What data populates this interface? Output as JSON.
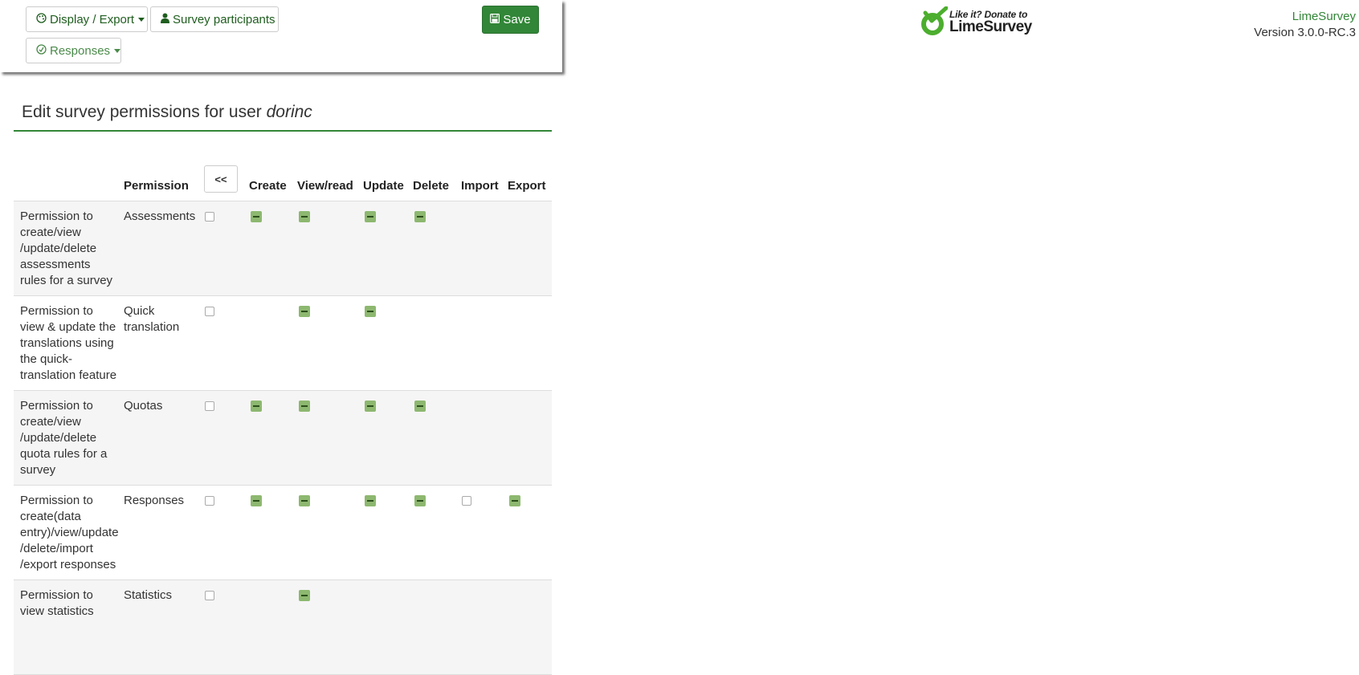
{
  "toolbar": {
    "display_export_label": "Display / Export",
    "survey_participants_label": "Survey participants",
    "responses_label": "Responses",
    "save_label": "Save"
  },
  "logo": {
    "small_text": "Like it? Donate to",
    "big_text": "LimeSurvey",
    "icon": "limesurvey-logo-icon"
  },
  "brand": {
    "name": "LimeSurvey",
    "version": "Version 3.0.0-RC.3"
  },
  "page": {
    "title_prefix": "Edit survey permissions for user ",
    "username": "dorinc"
  },
  "table": {
    "headers": {
      "permission": "Permission",
      "back_button": "<<",
      "create": "Create",
      "view": "View/read",
      "update": "Update",
      "delete": "Delete",
      "import": "Import",
      "export": "Export"
    },
    "rows": [
      {
        "description": "Permission to create/view /update/delete assessments rules for a survey",
        "name": "Assessments",
        "cells": {
          "all": "checkbox",
          "create": "indeterminate",
          "view": "indeterminate",
          "update": "indeterminate",
          "delete": "indeterminate",
          "import": "none",
          "export": "none"
        }
      },
      {
        "description": "Permission to view & update the translations using the quick-translation feature",
        "name": "Quick translation",
        "cells": {
          "all": "checkbox",
          "create": "none",
          "view": "indeterminate",
          "update": "indeterminate",
          "delete": "none",
          "import": "none",
          "export": "none"
        }
      },
      {
        "description": "Permission to create/view /update/delete quota rules for a survey",
        "name": "Quotas",
        "cells": {
          "all": "checkbox",
          "create": "indeterminate",
          "view": "indeterminate",
          "update": "indeterminate",
          "delete": "indeterminate",
          "import": "none",
          "export": "none"
        }
      },
      {
        "description": "Permission to create(data entry)/view/update /delete/import /export responses",
        "name": "Responses",
        "cells": {
          "all": "checkbox",
          "create": "indeterminate",
          "view": "indeterminate",
          "update": "indeterminate",
          "delete": "indeterminate",
          "import": "checkbox",
          "export": "indeterminate"
        }
      },
      {
        "description": "Permission to view statistics",
        "name": "Statistics",
        "cells": {
          "all": "checkbox",
          "create": "none",
          "view": "indeterminate",
          "update": "none",
          "delete": "none",
          "import": "none",
          "export": "none"
        }
      }
    ]
  },
  "colors": {
    "accent": "#328637",
    "indeterminate": "#8db870"
  }
}
